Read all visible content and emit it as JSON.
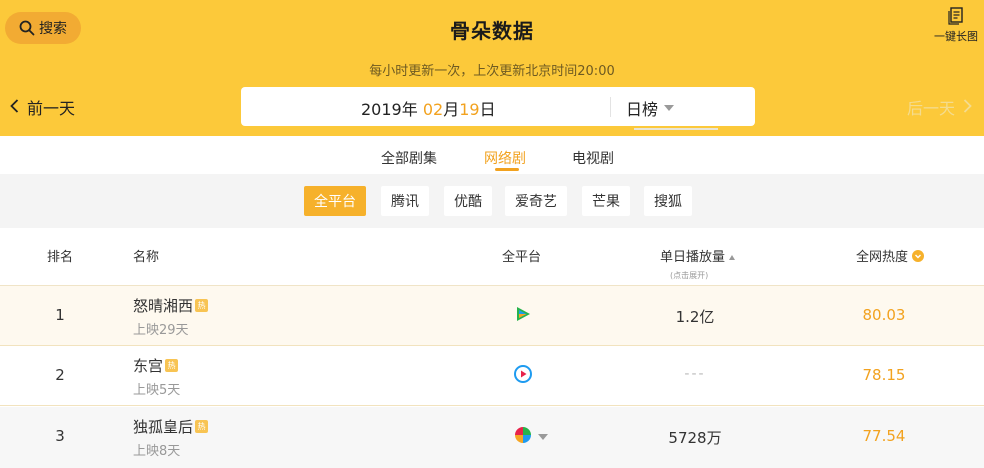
{
  "header": {
    "search_label": "搜索",
    "title": "骨朵数据",
    "longshot_label": "一键长图",
    "update_note": "每小时更新一次，上次更新北京时间20:00",
    "prev_label": "前一天",
    "next_label": "后一天",
    "date": {
      "year": "2019",
      "year_unit": "年",
      "month": "02",
      "month_unit": "月",
      "day": "19",
      "day_unit": "日"
    },
    "rank_type": "日榜"
  },
  "categories": [
    {
      "label": "全部剧集",
      "active": false
    },
    {
      "label": "网络剧",
      "active": true
    },
    {
      "label": "电视剧",
      "active": false
    }
  ],
  "platforms": [
    {
      "label": "全平台",
      "active": true
    },
    {
      "label": "腾讯",
      "active": false
    },
    {
      "label": "优酷",
      "active": false
    },
    {
      "label": "爱奇艺",
      "active": false
    },
    {
      "label": "芒果",
      "active": false
    },
    {
      "label": "搜狐",
      "active": false
    }
  ],
  "table": {
    "headers": {
      "rank": "排名",
      "name": "名称",
      "platform": "全平台",
      "plays": "单日播放量",
      "plays_hint": "(点击展开)",
      "heat": "全网热度"
    },
    "hot_tag": "热",
    "rows": [
      {
        "rank": "1",
        "name": "怒晴湘西",
        "sub": "上映29天",
        "platform_icon": "tencent-video-icon",
        "plays": "1.2亿",
        "heat": "80.03"
      },
      {
        "rank": "2",
        "name": "东宫",
        "sub": "上映5天",
        "platform_icon": "youku-icon",
        "plays": "---",
        "heat": "78.15"
      },
      {
        "rank": "3",
        "name": "独孤皇后",
        "sub": "上映8天",
        "platform_icon": "multi-platform-icon",
        "plays": "5728万",
        "heat": "77.54"
      }
    ]
  },
  "colors": {
    "brand_yellow": "#fcc93a",
    "accent_orange": "#f2a21f",
    "platform_active": "#f6b12b"
  }
}
